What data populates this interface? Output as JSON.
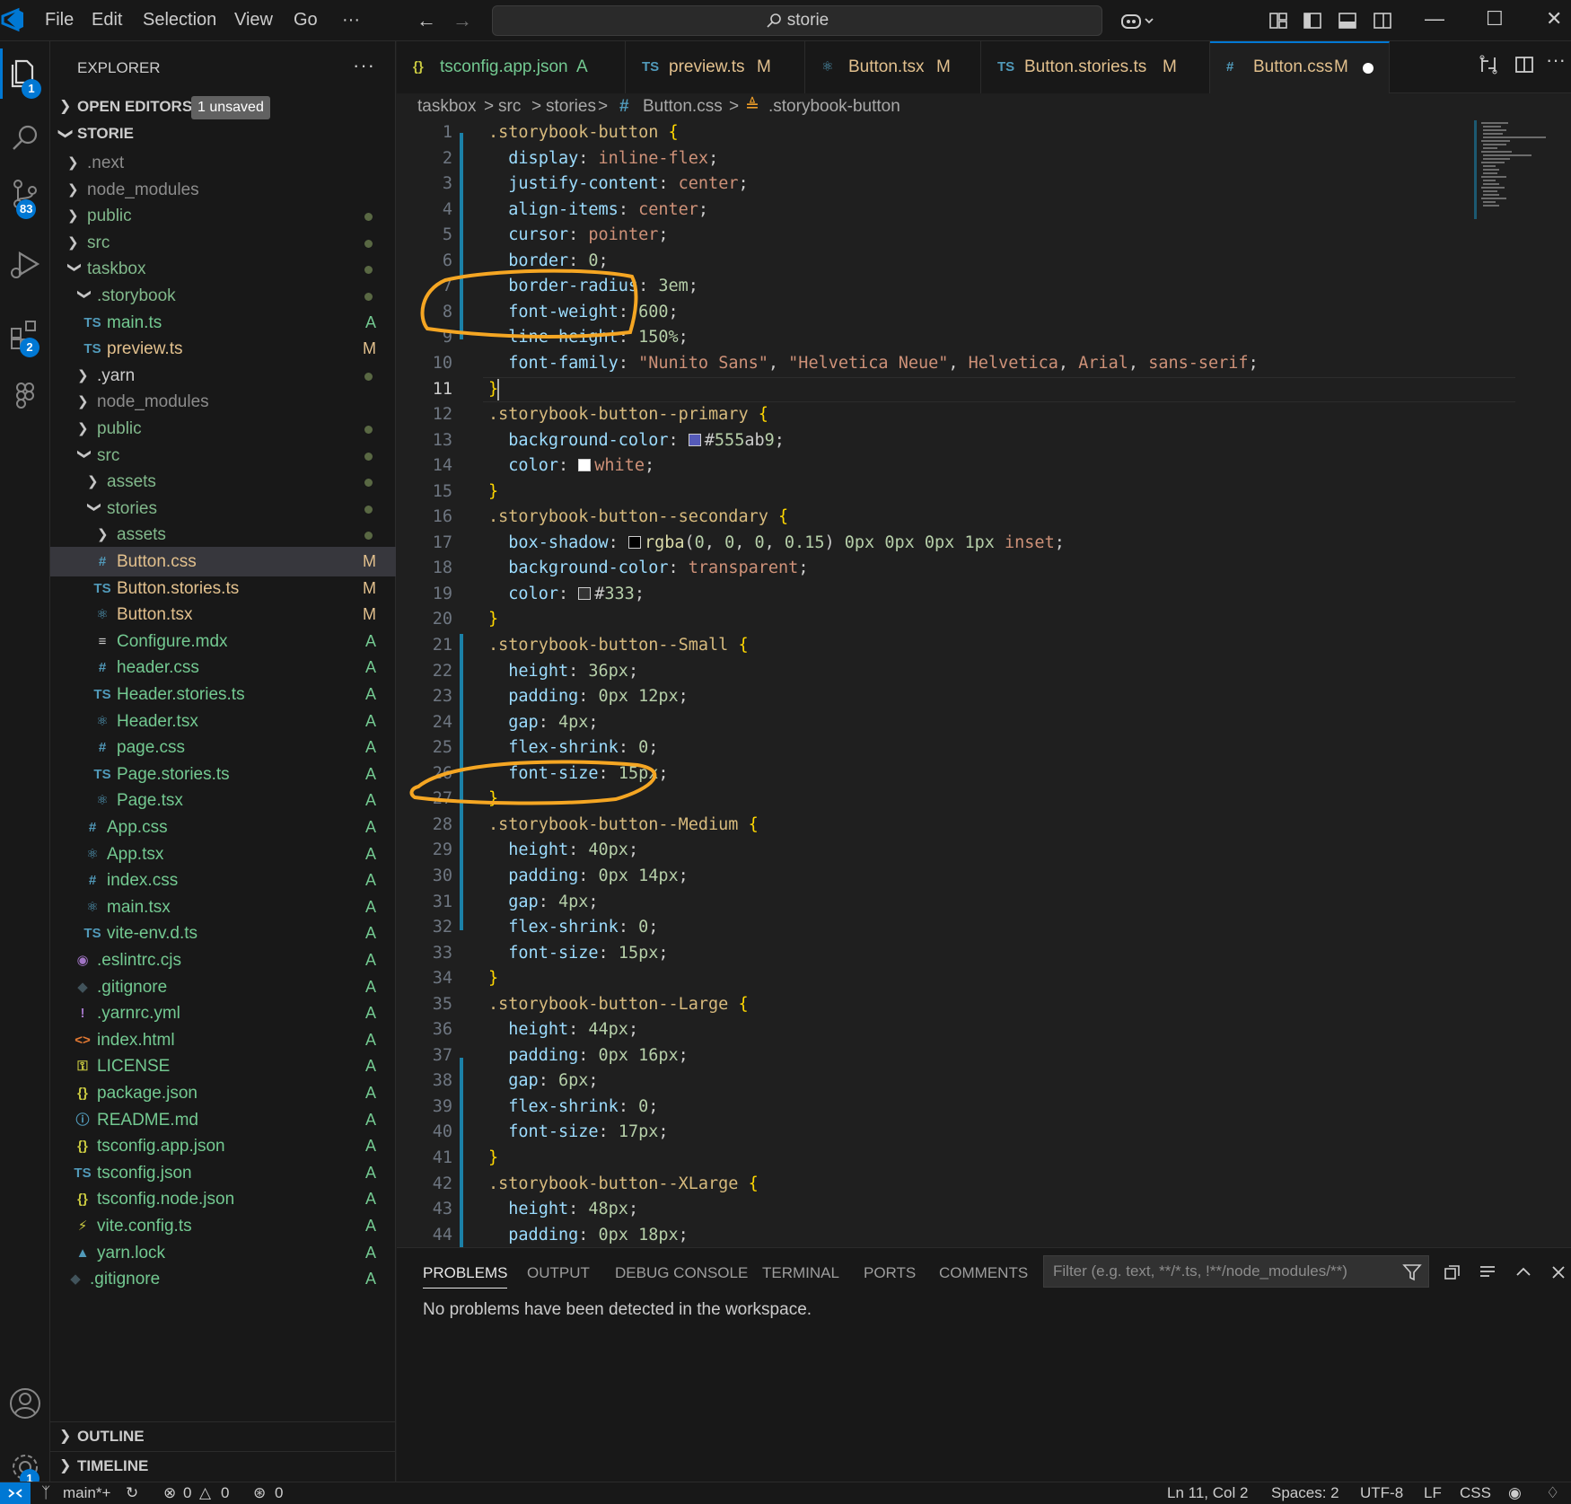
{
  "menu": [
    "File",
    "Edit",
    "Selection",
    "View",
    "Go",
    "···"
  ],
  "search": {
    "text": "storie"
  },
  "activity": {
    "explorer_badge": "1",
    "scm_badge": "83",
    "extensions_badge": "2",
    "settings_badge": "1"
  },
  "sidebar": {
    "title": "EXPLORER",
    "open_editors": "OPEN EDITORS",
    "unsaved_pill": "1 unsaved",
    "root": "STORIE",
    "outline": "OUTLINE",
    "timeline": "TIMELINE",
    "tree": [
      {
        "name": ".next",
        "status": ""
      },
      {
        "name": "node_modules",
        "status": ""
      },
      {
        "name": "public",
        "status": "dot"
      },
      {
        "name": "src",
        "status": "dot"
      },
      {
        "name": "taskbox",
        "status": "dot"
      },
      {
        "name": ".storybook",
        "status": "dot"
      },
      {
        "name": "main.ts",
        "status": "A"
      },
      {
        "name": "preview.ts",
        "status": "M"
      },
      {
        "name": ".yarn",
        "status": "dot"
      },
      {
        "name": "node_modules",
        "status": ""
      },
      {
        "name": "public",
        "status": "dot"
      },
      {
        "name": "src",
        "status": "dot"
      },
      {
        "name": "assets",
        "status": "dot"
      },
      {
        "name": "stories",
        "status": "dot"
      },
      {
        "name": "assets",
        "status": "dot"
      },
      {
        "name": "Button.css",
        "status": "M"
      },
      {
        "name": "Button.stories.ts",
        "status": "M"
      },
      {
        "name": "Button.tsx",
        "status": "M"
      },
      {
        "name": "Configure.mdx",
        "status": "A"
      },
      {
        "name": "header.css",
        "status": "A"
      },
      {
        "name": "Header.stories.ts",
        "status": "A"
      },
      {
        "name": "Header.tsx",
        "status": "A"
      },
      {
        "name": "page.css",
        "status": "A"
      },
      {
        "name": "Page.stories.ts",
        "status": "A"
      },
      {
        "name": "Page.tsx",
        "status": "A"
      },
      {
        "name": "App.css",
        "status": "A"
      },
      {
        "name": "App.tsx",
        "status": "A"
      },
      {
        "name": "index.css",
        "status": "A"
      },
      {
        "name": "main.tsx",
        "status": "A"
      },
      {
        "name": "vite-env.d.ts",
        "status": "A"
      },
      {
        "name": ".eslintrc.cjs",
        "status": "A"
      },
      {
        "name": ".gitignore",
        "status": "A"
      },
      {
        "name": ".yarnrc.yml",
        "status": "A"
      },
      {
        "name": "index.html",
        "status": "A"
      },
      {
        "name": "LICENSE",
        "status": "A"
      },
      {
        "name": "package.json",
        "status": "A"
      },
      {
        "name": "README.md",
        "status": "A"
      },
      {
        "name": "tsconfig.app.json",
        "status": "A"
      },
      {
        "name": "tsconfig.json",
        "status": "A"
      },
      {
        "name": "tsconfig.node.json",
        "status": "A"
      },
      {
        "name": "vite.config.ts",
        "status": "A"
      },
      {
        "name": "yarn.lock",
        "status": "A"
      },
      {
        "name": ".gitignore",
        "status": "A"
      }
    ]
  },
  "tabs": [
    {
      "label": "tsconfig.app.json",
      "status": "A"
    },
    {
      "label": "preview.ts",
      "status": "M"
    },
    {
      "label": "Button.tsx",
      "status": "M"
    },
    {
      "label": "Button.stories.ts",
      "status": "M"
    },
    {
      "label": "Button.css",
      "status": "M"
    }
  ],
  "breadcrumb": [
    "taskbox",
    ">",
    "src",
    ">",
    "stories",
    ">",
    "Button.css",
    ">",
    ".storybook-button"
  ],
  "editor": {
    "current_line": 11,
    "lines": [
      ".storybook-button {",
      "  display: inline-flex;",
      "  justify-content: center;",
      "  align-items: center;",
      "  cursor: pointer;",
      "  border: 0;",
      "  border-radius: 3em;",
      "  font-weight: 600;",
      "  line-height: 150%;",
      "  font-family: \"Nunito Sans\", \"Helvetica Neue\", Helvetica, Arial, sans-serif;",
      "}",
      ".storybook-button--primary {",
      "  background-color: #555ab9;",
      "  color: white;",
      "}",
      ".storybook-button--secondary {",
      "  box-shadow: rgba(0, 0, 0, 0.15) 0px 0px 0px 1px inset;",
      "  background-color: transparent;",
      "  color: #333;",
      "}",
      ".storybook-button--Small {",
      "  height: 36px;",
      "  padding: 0px 12px;",
      "  gap: 4px;",
      "  flex-shrink: 0;",
      "  font-size: 15px;",
      "}",
      ".storybook-button--Medium {",
      "  height: 40px;",
      "  padding: 0px 14px;",
      "  gap: 4px;",
      "  flex-shrink: 0;",
      "  font-size: 15px;",
      "}",
      ".storybook-button--Large {",
      "  height: 44px;",
      "  padding: 0px 16px;",
      "  gap: 6px;",
      "  flex-shrink: 0;",
      "  font-size: 17px;",
      "}",
      ".storybook-button--XLarge {",
      "  height: 48px;",
      "  padding: 0px 18px;"
    ],
    "swatches": {
      "primary": "#555ab9",
      "white": "#ffffff",
      "shadow": "#000000",
      "dark": "#333333"
    }
  },
  "panel": {
    "tabs": [
      "PROBLEMS",
      "OUTPUT",
      "DEBUG CONSOLE",
      "TERMINAL",
      "PORTS",
      "COMMENTS"
    ],
    "filter_placeholder": "Filter (e.g. text, **/*.ts, !**/node_modules/**)",
    "message": "No problems have been detected in the workspace."
  },
  "status": {
    "branch": "main*+",
    "errors": "0",
    "warnings": "0",
    "ports": "0",
    "position": "Ln 11, Col 2",
    "spaces": "Spaces: 2",
    "encoding": "UTF-8",
    "eol": "LF",
    "language": "CSS"
  },
  "colors": {
    "accent": "#0078d4",
    "annotation": "#f5a623",
    "git_added": "#73c991",
    "git_modified": "#e2c08d"
  }
}
